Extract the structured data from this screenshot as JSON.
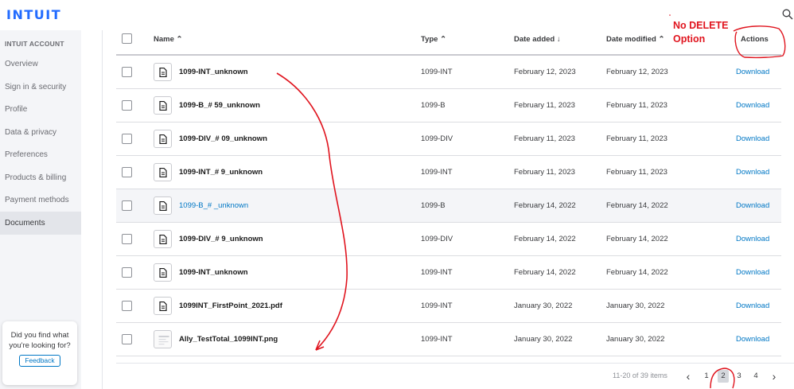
{
  "header": {
    "logo": "INTUIT",
    "search_icon": "search-icon"
  },
  "sidebar": {
    "heading": "INTUIT ACCOUNT",
    "items": [
      {
        "label": "Overview"
      },
      {
        "label": "Sign in & security"
      },
      {
        "label": "Profile"
      },
      {
        "label": "Data & privacy"
      },
      {
        "label": "Preferences"
      },
      {
        "label": "Products & billing"
      },
      {
        "label": "Payment methods"
      },
      {
        "label": "Documents",
        "active": true
      }
    ],
    "feedback": {
      "prompt": "Did you find what you're looking for?",
      "button": "Feedback"
    }
  },
  "table": {
    "columns": {
      "name": "Name ⌃",
      "type": "Type ⌃",
      "date_added": "Date added ↓",
      "date_modified": "Date modified ⌃",
      "actions": "Actions"
    },
    "rows": [
      {
        "name": "1099-INT_unknown",
        "type": "1099-INT",
        "added": "February 12, 2023",
        "modified": "February 12, 2023",
        "action": "Download"
      },
      {
        "name": "1099-B_#   59_unknown",
        "type": "1099-B",
        "added": "February 11, 2023",
        "modified": "February 11, 2023",
        "action": "Download"
      },
      {
        "name": "1099-DIV_#   09_unknown",
        "type": "1099-DIV",
        "added": "February 11, 2023",
        "modified": "February 11, 2023",
        "action": "Download"
      },
      {
        "name": "1099-INT_#   9_unknown",
        "type": "1099-INT",
        "added": "February 11, 2023",
        "modified": "February 11, 2023",
        "action": "Download"
      },
      {
        "name": "1099-B_#   _unknown",
        "type": "1099-B",
        "added": "February 14, 2022",
        "modified": "February 14, 2022",
        "action": "Download",
        "highlight": true
      },
      {
        "name": "1099-DIV_#      9_unknown",
        "type": "1099-DIV",
        "added": "February 14, 2022",
        "modified": "February 14, 2022",
        "action": "Download"
      },
      {
        "name": "1099-INT_unknown",
        "type": "1099-INT",
        "added": "February 14, 2022",
        "modified": "February 14, 2022",
        "action": "Download"
      },
      {
        "name": "1099INT_FirstPoint_2021.pdf",
        "type": "1099-INT",
        "added": "January 30, 2022",
        "modified": "January 30, 2022",
        "action": "Download"
      },
      {
        "name": "Ally_TestTotal_1099INT.png",
        "type": "1099-INT",
        "added": "January 30, 2022",
        "modified": "January 30, 2022",
        "action": "Download",
        "thumbnail": true
      }
    ]
  },
  "pagination": {
    "summary": "11-20 of 39 items",
    "prev": "‹",
    "next": "›",
    "pages": [
      "1",
      "2",
      "3",
      "4"
    ],
    "current": "2"
  },
  "annotation": {
    "text_line1": "No DELETE",
    "text_line2": "Option",
    "color": "#e0141e"
  },
  "colors": {
    "brand": "#236cff",
    "link": "#0077c5",
    "sidebar_bg": "#f4f5f8"
  }
}
